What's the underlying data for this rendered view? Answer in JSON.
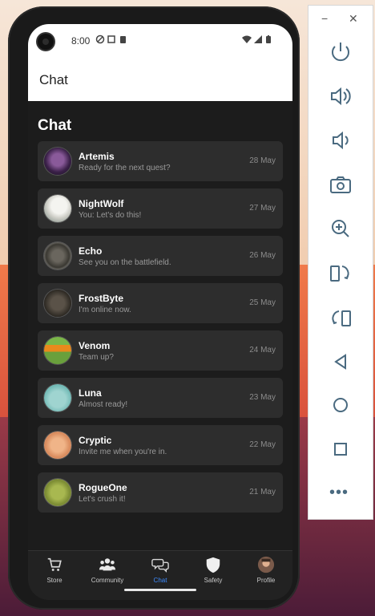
{
  "status_bar": {
    "time": "8:00"
  },
  "app_bar": {
    "title": "Chat"
  },
  "section": {
    "title": "Chat"
  },
  "chats": [
    {
      "name": "Artemis",
      "message": "Ready for the next quest?",
      "date": "28 May"
    },
    {
      "name": "NightWolf",
      "message": "You: Let's do this!",
      "date": "27 May"
    },
    {
      "name": "Echo",
      "message": "See you on the battlefield.",
      "date": "26 May"
    },
    {
      "name": "FrostByte",
      "message": "I'm online now.",
      "date": "25 May"
    },
    {
      "name": "Venom",
      "message": "Team up?",
      "date": "24 May"
    },
    {
      "name": "Luna",
      "message": "Almost ready!",
      "date": "23 May"
    },
    {
      "name": "Cryptic",
      "message": "Invite me when you're in.",
      "date": "22 May"
    },
    {
      "name": "RogueOne",
      "message": "Let's crush it!",
      "date": "21 May"
    }
  ],
  "bottom_nav": [
    {
      "label": "Store",
      "icon": "cart-icon"
    },
    {
      "label": "Community",
      "icon": "people-icon"
    },
    {
      "label": "Chat",
      "icon": "chat-bubbles-icon",
      "active": true
    },
    {
      "label": "Safety",
      "icon": "shield-icon"
    },
    {
      "label": "Profile",
      "icon": "profile-avatar-icon"
    }
  ],
  "emulator_panel": {
    "window_controls": {
      "minimize": "−",
      "close": "✕"
    },
    "tools": [
      "power-icon",
      "volume-up-icon",
      "volume-down-icon",
      "camera-icon",
      "zoom-in-icon",
      "rotate-left-icon",
      "rotate-right-icon",
      "back-icon",
      "home-icon",
      "overview-icon",
      "more-icon"
    ],
    "more": "•••"
  },
  "colors": {
    "accent": "#3d8bff",
    "card": "#2d2d2d",
    "background": "#1c1c1c"
  }
}
